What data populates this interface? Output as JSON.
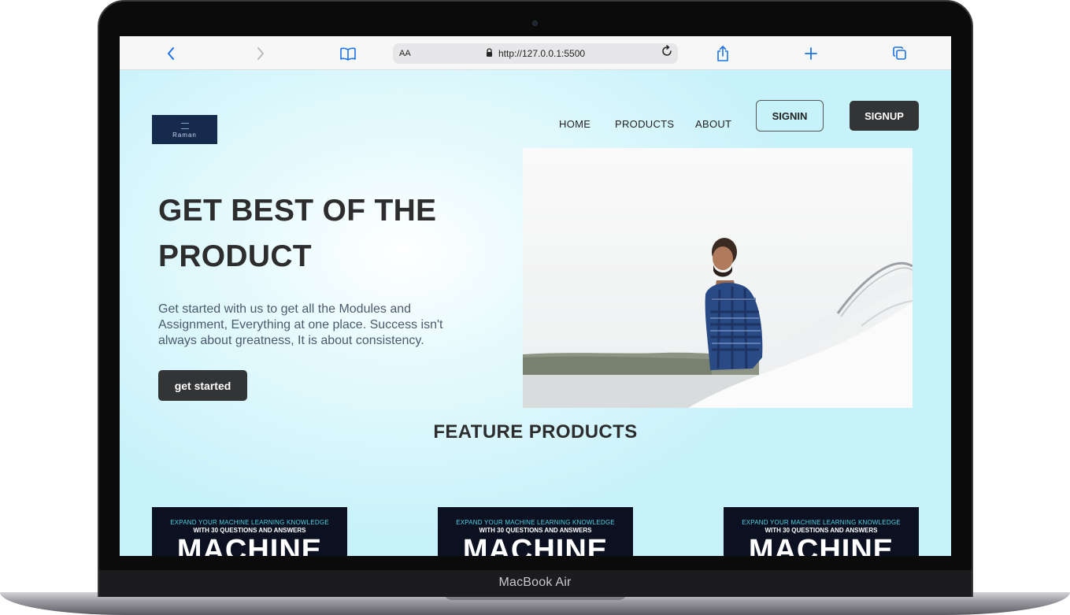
{
  "device": {
    "label": "MacBook Air"
  },
  "browser": {
    "text_size_label": "AA",
    "url": "http://127.0.0.1:5500",
    "icons": {
      "back": "chevron-left-icon",
      "forward": "chevron-right-icon",
      "bookmarks": "book-icon",
      "lock": "lock-icon",
      "reload": "reload-icon",
      "share": "share-icon",
      "new_tab": "plus-icon",
      "tabs": "tabs-icon"
    }
  },
  "site": {
    "logo_text": "Raman",
    "nav": [
      {
        "label": "HOME"
      },
      {
        "label": "PRODUCTS"
      },
      {
        "label": "ABOUT"
      }
    ],
    "signin_label": "SIGNIN",
    "signup_label": "SIGNUP",
    "hero": {
      "title_line1": "GET BEST OF THE",
      "title_line2": "PRODUCT",
      "description": "Get started with us to get all the Modules and Assignment, Everything at one place. Success isn't always about greatness, It is about consistency.",
      "cta_label": "get started"
    },
    "featured": {
      "title": "FEATURE PRODUCTS",
      "cards": [
        {
          "line1": "EXPAND YOUR MACHINE LEARNING KNOWLEDGE",
          "line2": "WITH 30 QUESTIONS AND ANSWERS",
          "big": "MACHINE"
        },
        {
          "line1": "EXPAND YOUR MACHINE LEARNING KNOWLEDGE",
          "line2": "WITH 30 QUESTIONS AND ANSWERS",
          "big": "MACHINE"
        },
        {
          "line1": "EXPAND YOUR MACHINE LEARNING KNOWLEDGE",
          "line2": "WITH 30 QUESTIONS AND ANSWERS",
          "big": "MACHINE"
        }
      ]
    }
  },
  "colors": {
    "accent": "#1a73e8",
    "dark_button": "#333436",
    "page_bg": "#c8f2fa"
  }
}
